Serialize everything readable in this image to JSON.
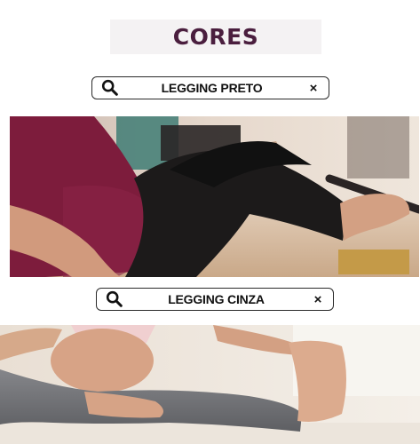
{
  "header": {
    "title": "CORES"
  },
  "options": [
    {
      "label": "LEGGING PRETO",
      "search_icon": "search-icon",
      "close_symbol": "×",
      "color": "#1c1a1a"
    },
    {
      "label": "LEGGING CINZA",
      "search_icon": "search-icon",
      "close_symbol": "×",
      "color": "#6f6f72"
    }
  ],
  "colors": {
    "title": "#4a1e3e",
    "title_bg": "#f4f2f3",
    "top_maroon": "#7d1c3c"
  }
}
